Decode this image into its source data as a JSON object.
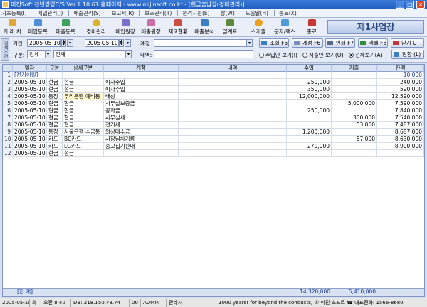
{
  "window": {
    "title": "미진Soft 천년경영C/S Ver.1.10.63     홈페이지 - www.mijinsoft.co.kr - [현금출납장(경비관리)]"
  },
  "menu": [
    "기초등록(I)",
    "매입관리(J)",
    "매출관리(S)",
    "보고서(R)",
    "보조관리(T)",
    "원격지원(E)",
    "창(W)",
    "도움말(H)",
    "종료(X)"
  ],
  "toolbar": {
    "buttons": [
      "거 래 처",
      "매입등록",
      "매출등록",
      "경비관리",
      "매입원장",
      "매출원장",
      "재고현황",
      "매출분석",
      "일계표",
      "스케쥴",
      "문자/팩스",
      "종료"
    ],
    "business_label": "제1사업장"
  },
  "filter": {
    "side_tab": "검색조건",
    "period_label": "기간:",
    "date_from": "2005-05-10",
    "tilde": "~",
    "date_to": "2005-05-10",
    "account_label": "계정:",
    "account_value": "",
    "type_label": "구분:",
    "type_value": "전체",
    "sub_type_value": "전체",
    "detail_label": "내역:",
    "detail_value": "",
    "actions": {
      "search": "조회 F5",
      "account": "계정 F6",
      "print": "인쇄 F7",
      "excel": "엑셀 F8",
      "close": "닫기 C",
      "status": "현황 (L)"
    },
    "radios": [
      "수입만 보기(I)",
      "지출만 보기(O)",
      "전체보기(A)"
    ],
    "radio_selected": "전체보기(A)"
  },
  "grid": {
    "headers": [
      "",
      "일자",
      "구분",
      "상세구분",
      "계정",
      "내역",
      "수입",
      "지출",
      "잔액"
    ],
    "rows": [
      [
        "1",
        "[전기이월]",
        "",
        "",
        "",
        "",
        "",
        "",
        "-10,000"
      ],
      [
        "2",
        "2005-05-10",
        "현금",
        "현금",
        "이자수입",
        "",
        "250,000",
        "",
        "240,000"
      ],
      [
        "3",
        "2005-05-10",
        "현금",
        "현금",
        "이자수입",
        "",
        "350,000",
        "",
        "590,000"
      ],
      [
        "4",
        "2005-05-10",
        "통장",
        "우리은행 예비통",
        "배상",
        "",
        "12,000,000",
        "",
        "12,590,000"
      ],
      [
        "5",
        "2005-05-10",
        "현금",
        "현금",
        "사무실보증금",
        "",
        "",
        "5,000,000",
        "7,590,000"
      ],
      [
        "6",
        "2005-05-10",
        "현금",
        "현금",
        "공과금",
        "",
        "250,000",
        "",
        "7,840,000"
      ],
      [
        "7",
        "2005-05-10",
        "현금",
        "현금",
        "사무실세",
        "",
        "",
        "300,000",
        "7,540,000"
      ],
      [
        "8",
        "2005-05-10",
        "현금",
        "현금",
        "전기세",
        "",
        "",
        "53,000",
        "7,487,000"
      ],
      [
        "9",
        "2005-05-10",
        "통장",
        "서울은행 수금통",
        "외상대수금",
        "",
        "1,200,000",
        "",
        "8,687,000"
      ],
      [
        "10",
        "2005-05-10",
        "카드",
        "BC카드",
        "사장님차기름",
        "",
        "",
        "57,000",
        "8,630,000"
      ],
      [
        "11",
        "2005-05-10",
        "카드",
        "LG카드",
        "중고집기판매",
        "",
        "270,000",
        "",
        "8,900,000"
      ],
      [
        "12",
        "2005-05-10",
        "현금",
        "현금",
        "",
        "",
        "",
        "",
        ""
      ]
    ],
    "footer_label": "[합 계]",
    "total_income": "14,320,000",
    "total_expense": "5,410,000"
  },
  "status_bar": [
    "2005-05-10",
    "화",
    "오전 8:40",
    "DB: 218.150.78.74",
    "00",
    "ADMIN",
    "관리자",
    "1000 years! for beyond the conducts,  ® 미진 소프트  ☎ 대표전화: 1566-8680"
  ],
  "colors": {
    "title": "#1f5cbf",
    "accent": "#27467f",
    "total_text": "#1b3f93"
  }
}
